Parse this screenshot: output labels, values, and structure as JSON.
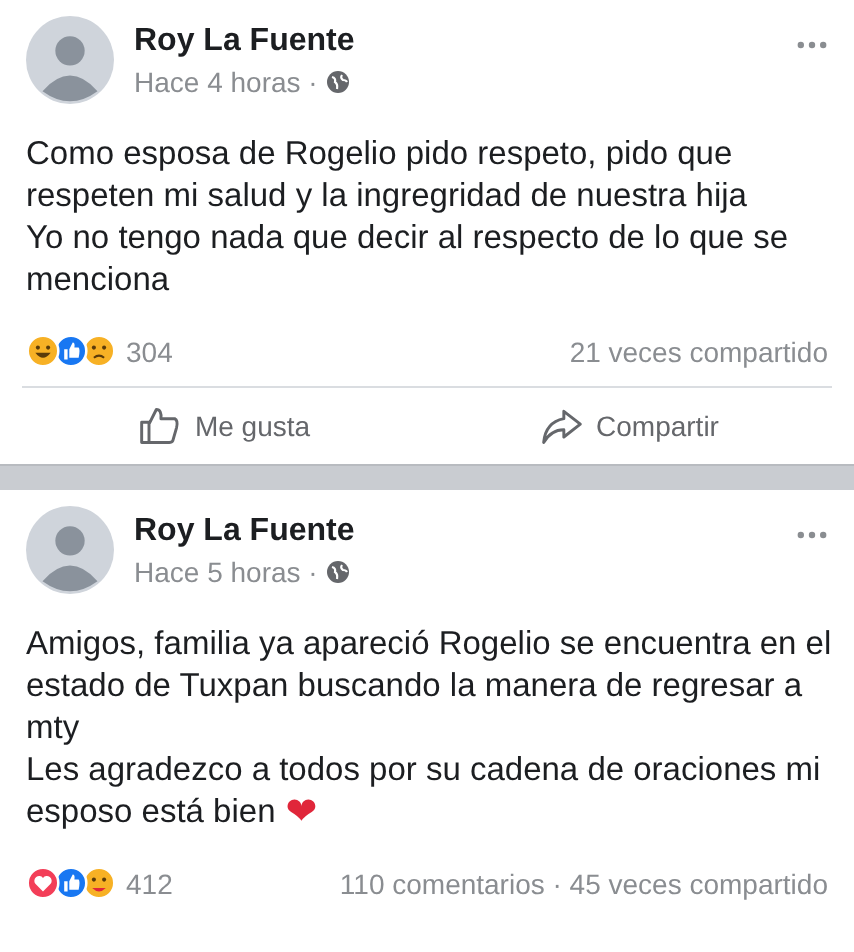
{
  "posts": [
    {
      "author": "Roy La Fuente",
      "time": "Hace 4 horas ·",
      "lines": [
        "Como esposa de Rogelio pido respeto, pido que",
        "respeten mi salud y la ingregridad de nuestra hija",
        "Yo no tengo nada que decir al respecto de lo que se",
        "menciona"
      ],
      "reactions": [
        {
          "kind": "haha"
        },
        {
          "kind": "like"
        },
        {
          "kind": "sad"
        }
      ],
      "reaction_count": "304",
      "stats": "21 veces compartido",
      "actions": [
        {
          "kind": "like",
          "label": "Me gusta"
        },
        {
          "kind": "share",
          "label": "Compartir"
        }
      ]
    },
    {
      "author": "Roy La Fuente",
      "time": "Hace 5 horas ·",
      "lines": [
        "Amigos, familia ya apareció Rogelio se encuentra en el",
        "estado de Tuxpan buscando la manera de regresar a",
        "mty",
        "Les agradezco a todos por su cadena de oraciones mi",
        "esposo está bien"
      ],
      "end_mark": "❤",
      "reactions": [
        {
          "kind": "love"
        },
        {
          "kind": "like"
        },
        {
          "kind": "care"
        }
      ],
      "reaction_count": "412",
      "stats": "110 comentarios · 45 veces compartido"
    }
  ]
}
